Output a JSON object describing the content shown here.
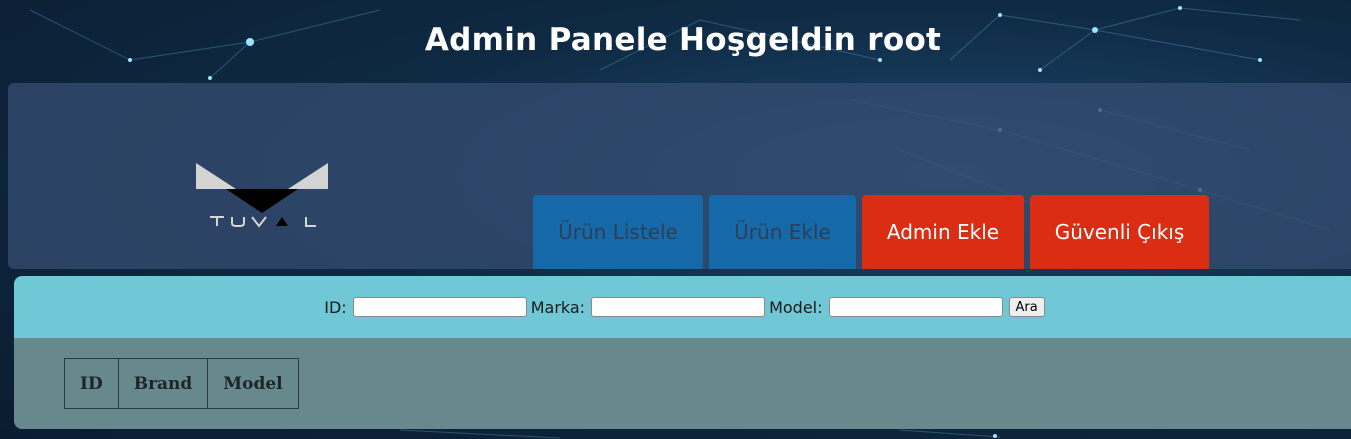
{
  "header": {
    "title": "Admin Panele Hoşgeldin root"
  },
  "logo": {
    "text": "TUVAL"
  },
  "nav": {
    "list_products": "Ürün Listele",
    "add_product": "Ürün Ekle",
    "add_admin": "Admin Ekle",
    "logout": "Güvenli Çıkış"
  },
  "search": {
    "id_label": "ID:",
    "id_value": "",
    "brand_label": "Marka:",
    "brand_value": "",
    "model_label": "Model:",
    "model_value": "",
    "submit_label": "Ara"
  },
  "table": {
    "columns": [
      "ID",
      "Brand",
      "Model"
    ]
  },
  "colors": {
    "nav_blue": "#1569a8",
    "nav_red": "#db2d14",
    "search_bar": "#70c7d6",
    "table_area": "#67888d"
  }
}
